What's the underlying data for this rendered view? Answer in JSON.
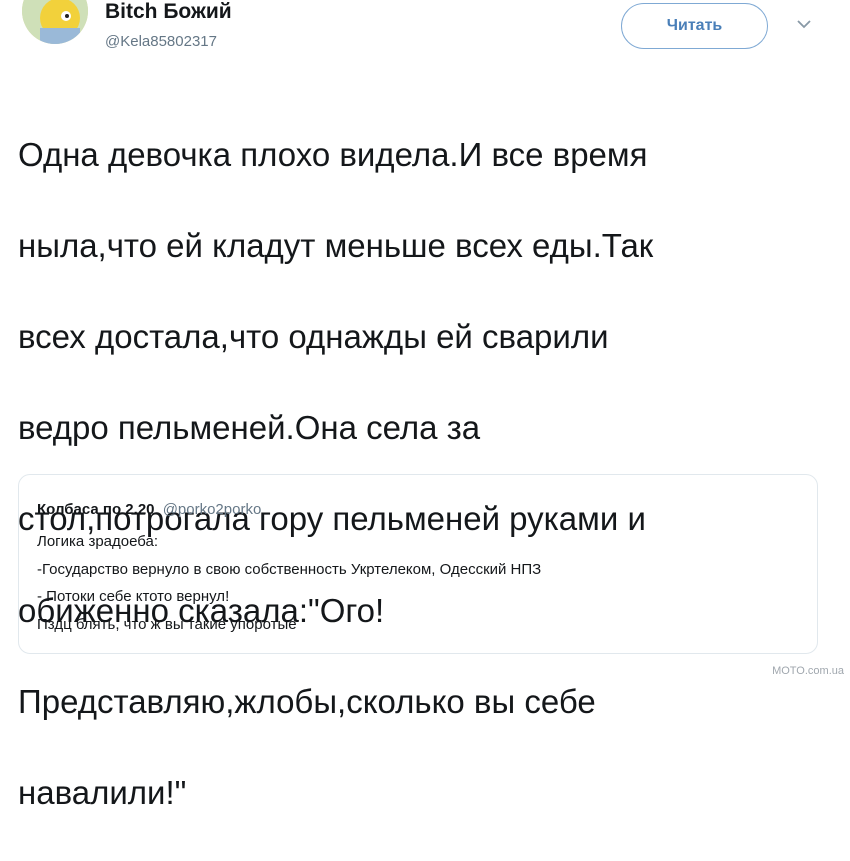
{
  "tweet": {
    "author": {
      "display_name": "Bitch Божий",
      "handle": "@Kela85802317"
    },
    "follow_label": "Читать",
    "text_lines": [
      "Одна девочка плохо видела.И все время",
      "ныла,что ей кладут меньше всех еды.Так",
      "всех достала,что однажды ей сварили",
      "ведро пельменей.Она села за",
      "стол,потрогала гору пельменей руками и",
      "обиженно сказала:\"Ого!",
      "Представляю,жлобы,сколько вы себе",
      "навалили!\""
    ]
  },
  "quoted_tweet": {
    "author_name": "Колбаса по 2.20",
    "author_handle": "@porko2porko",
    "lines": [
      "Логика зрадоеба:",
      "-Государство вернуло в свою собственность Укртелеком, Одесский НПЗ",
      "- Потоки себе ктото вернул!",
      "Пздц блять, что ж вы такие упоротые"
    ]
  },
  "watermark": "MOTO.com.ua",
  "colors": {
    "follow_accent": "#4a7fb8",
    "secondary_text": "#657786",
    "border": "#e1e8ed"
  },
  "icons": {
    "avatar": "simpson-avatar",
    "menu": "chevron-down-icon"
  }
}
